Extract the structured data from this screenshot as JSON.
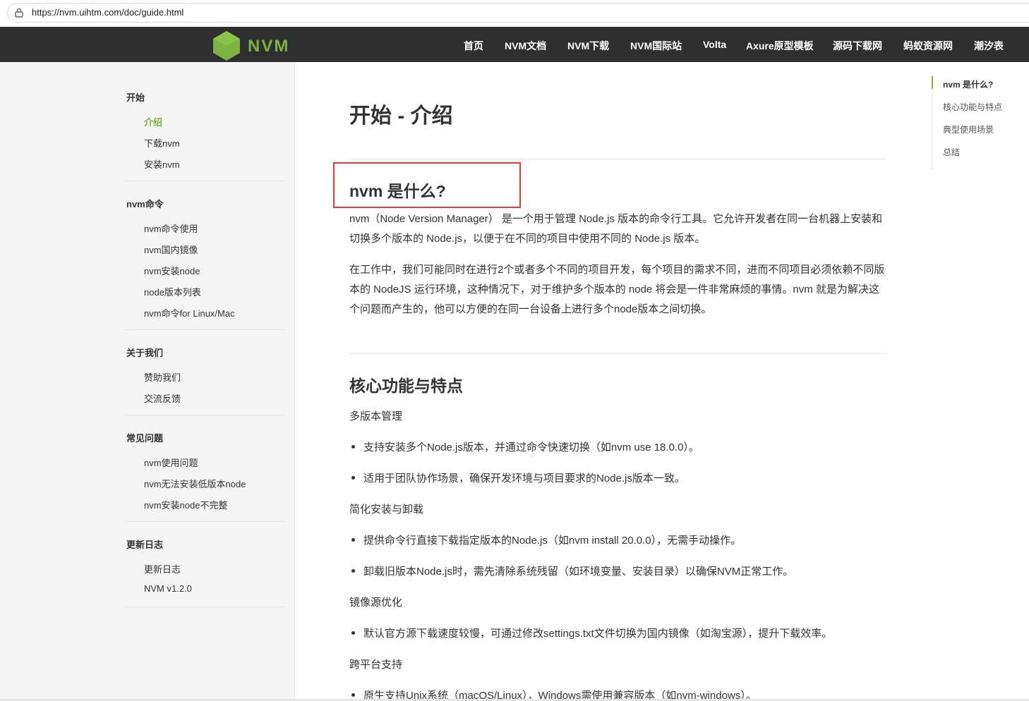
{
  "browser": {
    "url": "https://nvm.uihtm.com/doc/guide.html"
  },
  "header": {
    "logo_text": "NVM",
    "nav": [
      "首页",
      "NVM文档",
      "NVM下载",
      "NVM国际站",
      "Volta",
      "Axure原型模板",
      "源码下载网",
      "蚂蚁资源网",
      "潮汐表"
    ],
    "brand_color": "#7cb342"
  },
  "sidebar": {
    "sections": [
      {
        "title": "开始",
        "items": [
          "介绍",
          "下载nvm",
          "安装nvm"
        ]
      },
      {
        "title": "nvm命令",
        "items": [
          "nvm命令使用",
          "nvm国内镜像",
          "nvm安装node",
          "node版本列表",
          "nvm命令for Linux/Mac"
        ]
      },
      {
        "title": "关于我们",
        "items": [
          "赞助我们",
          "交流反馈"
        ]
      },
      {
        "title": "常见问题",
        "items": [
          "nvm使用问题",
          "nvm无法安装低版本node",
          "nvm安装node不完整"
        ]
      },
      {
        "title": "更新日志",
        "items": [
          "更新日志",
          "NVM v1.2.0"
        ]
      }
    ]
  },
  "main": {
    "title": "开始 - 介绍",
    "what": {
      "heading": "nvm 是什么?",
      "p1": "nvm（Node Version Manager） 是一个用于管理 Node.js 版本的命令行工具。它允许开发者在同一台机器上安装和切换多个版本的 Node.js，以便于在不同的项目中使用不同的 Node.js 版本。",
      "p2": "在工作中，我们可能同时在进行2个或者多个不同的项目开发，每个项目的需求不同，进而不同项目必须依赖不同版本的 NodeJS 运行环境，这种情况下，对于维护多个版本的 node 将会是一件非常麻烦的事情。nvm 就是为解决这个问题而产生的，他可以方便的在同一台设备上进行多个node版本之间切换。"
    },
    "features": {
      "heading": "核心功能与特点",
      "groups": [
        {
          "title": "多版本管理",
          "bullets": [
            "支持安装多个Node.js版本，并通过命令快速切换（如nvm use 18.0.0）。",
            "适用于团队协作场景，确保开发环境与项目要求的Node.js版本一致。"
          ]
        },
        {
          "title": "简化安装与卸载",
          "bullets": [
            "提供命令行直接下载指定版本的Node.js（如nvm install 20.0.0），无需手动操作。",
            "卸载旧版本Node.js时，需先清除系统残留（如环境变量、安装目录）以确保NVM正常工作。"
          ]
        },
        {
          "title": "镜像源优化",
          "bullets": [
            "默认官方源下载速度较慢，可通过修改settings.txt文件切换为国内镜像（如淘宝源），提升下载效率。"
          ]
        },
        {
          "title": "跨平台支持",
          "bullets": [
            "原生支持Unix系统（macOS/Linux），Windows需使用兼容版本（如nvm-windows）。"
          ]
        }
      ]
    }
  },
  "toc": {
    "items": [
      "nvm 是什么?",
      "核心功能与特点",
      "典型使用场景",
      "总结"
    ]
  }
}
